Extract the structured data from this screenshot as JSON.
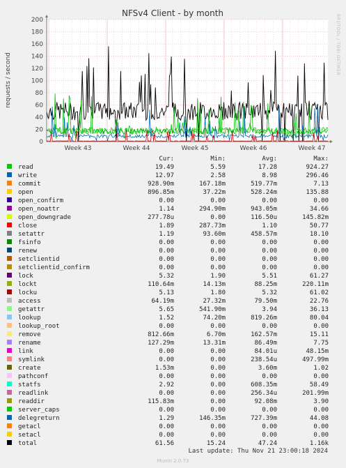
{
  "chart_data": {
    "type": "line",
    "title": "NFSv4 Client - by month",
    "ylabel": "requests / second",
    "side_label": "RRDTOOL / TOBI OETIKER",
    "ylim": [
      0,
      200
    ],
    "yticks": [
      0,
      20,
      40,
      60,
      80,
      100,
      120,
      140,
      160,
      180,
      200
    ],
    "xticks": [
      "Week 43",
      "Week 44",
      "Week 45",
      "Week 46",
      "Week 47"
    ],
    "grid": true,
    "series": [
      {
        "name": "total",
        "color": "#000000",
        "approx_level": 50,
        "approx_range": [
          0,
          160
        ]
      },
      {
        "name": "getattr",
        "color": "#00cc00",
        "approx_level": 18,
        "approx_range": [
          5,
          40
        ]
      },
      {
        "name": "read",
        "color": "#00bb00",
        "approx_level": 17,
        "approx_range": [
          5,
          80
        ]
      },
      {
        "name": "write",
        "color": "#0066b3",
        "approx_level": 9,
        "approx_range": [
          2,
          60
        ]
      },
      {
        "name": "close",
        "color": "#cc0000",
        "approx_level": 1,
        "approx_range": [
          0,
          20
        ]
      }
    ]
  },
  "legend": {
    "headers": {
      "cur": "Cur:",
      "min": "Min:",
      "avg": "Avg:",
      "max": "Max:"
    },
    "rows": [
      {
        "name": "read",
        "color": "#00cc00",
        "cur": "19.49",
        "min": "5.59",
        "avg": "17.28",
        "max": "924.27"
      },
      {
        "name": "write",
        "color": "#0066b3",
        "cur": "12.97",
        "min": "2.58",
        "avg": "8.98",
        "max": "296.46"
      },
      {
        "name": "commit",
        "color": "#ff8000",
        "cur": "928.90m",
        "min": "167.18m",
        "avg": "519.77m",
        "max": "7.13"
      },
      {
        "name": "open",
        "color": "#ffcc00",
        "cur": "896.85m",
        "min": "37.22m",
        "avg": "528.24m",
        "max": "135.88"
      },
      {
        "name": "open_confirm",
        "color": "#330099",
        "cur": "0.00",
        "min": "0.00",
        "avg": "0.00",
        "max": "0.00"
      },
      {
        "name": "open_noattr",
        "color": "#990099",
        "cur": "1.14",
        "min": "294.90m",
        "avg": "943.05m",
        "max": "34.66"
      },
      {
        "name": "open_downgrade",
        "color": "#ccff00",
        "cur": "277.78u",
        "min": "0.00",
        "avg": "116.50u",
        "max": "145.82m"
      },
      {
        "name": "close",
        "color": "#ff0000",
        "cur": "1.89",
        "min": "287.73m",
        "avg": "1.10",
        "max": "50.77"
      },
      {
        "name": "setattr",
        "color": "#808080",
        "cur": "1.19",
        "min": "93.60m",
        "avg": "458.57m",
        "max": "18.10"
      },
      {
        "name": "fsinfo",
        "color": "#008f00",
        "cur": "0.00",
        "min": "0.00",
        "avg": "0.00",
        "max": "0.00"
      },
      {
        "name": "renew",
        "color": "#00487d",
        "cur": "0.00",
        "min": "0.00",
        "avg": "0.00",
        "max": "0.00"
      },
      {
        "name": "setclientid",
        "color": "#b35a00",
        "cur": "0.00",
        "min": "0.00",
        "avg": "0.00",
        "max": "0.00"
      },
      {
        "name": "setclientid_confirm",
        "color": "#b38f00",
        "cur": "0.00",
        "min": "0.00",
        "avg": "0.00",
        "max": "0.00"
      },
      {
        "name": "lock",
        "color": "#6b006b",
        "cur": "5.32",
        "min": "1.90",
        "avg": "5.51",
        "max": "61.27"
      },
      {
        "name": "lockt",
        "color": "#8fb300",
        "cur": "110.64m",
        "min": "14.13m",
        "avg": "88.25m",
        "max": "220.11m"
      },
      {
        "name": "locku",
        "color": "#b30000",
        "cur": "5.13",
        "min": "1.80",
        "avg": "5.32",
        "max": "61.02"
      },
      {
        "name": "access",
        "color": "#bebebe",
        "cur": "64.19m",
        "min": "27.32m",
        "avg": "79.50m",
        "max": "22.76"
      },
      {
        "name": "getattr",
        "color": "#80ff80",
        "cur": "5.65",
        "min": "541.90m",
        "avg": "3.94",
        "max": "36.13"
      },
      {
        "name": "lookup",
        "color": "#80c9ff",
        "cur": "1.52",
        "min": "74.20m",
        "avg": "819.26m",
        "max": "80.04"
      },
      {
        "name": "lookup_root",
        "color": "#ffc080",
        "cur": "0.00",
        "min": "0.00",
        "avg": "0.00",
        "max": "0.00"
      },
      {
        "name": "remove",
        "color": "#ffe680",
        "cur": "812.66m",
        "min": "6.70m",
        "avg": "162.57m",
        "max": "15.11"
      },
      {
        "name": "rename",
        "color": "#aa80ff",
        "cur": "127.29m",
        "min": "13.31m",
        "avg": "86.49m",
        "max": "7.75"
      },
      {
        "name": "link",
        "color": "#ee00cc",
        "cur": "0.00",
        "min": "0.00",
        "avg": "84.01u",
        "max": "48.15m"
      },
      {
        "name": "symlink",
        "color": "#ff8080",
        "cur": "0.00",
        "min": "0.00",
        "avg": "238.54u",
        "max": "497.99m"
      },
      {
        "name": "create",
        "color": "#666600",
        "cur": "1.53m",
        "min": "0.00",
        "avg": "3.60m",
        "max": "1.02"
      },
      {
        "name": "pathconf",
        "color": "#ffbfff",
        "cur": "0.00",
        "min": "0.00",
        "avg": "0.00",
        "max": "0.00"
      },
      {
        "name": "statfs",
        "color": "#00ffcc",
        "cur": "2.92",
        "min": "0.00",
        "avg": "608.35m",
        "max": "58.49"
      },
      {
        "name": "readlink",
        "color": "#cc6699",
        "cur": "0.00",
        "min": "0.00",
        "avg": "256.34u",
        "max": "201.99m"
      },
      {
        "name": "readdir",
        "color": "#999900",
        "cur": "115.83m",
        "min": "0.00",
        "avg": "92.08m",
        "max": "3.90"
      },
      {
        "name": "server_caps",
        "color": "#00cc00",
        "cur": "0.00",
        "min": "0.00",
        "avg": "0.00",
        "max": "0.00"
      },
      {
        "name": "delegreturn",
        "color": "#0066b3",
        "cur": "1.29",
        "min": "146.35m",
        "avg": "727.39m",
        "max": "44.08"
      },
      {
        "name": "getacl",
        "color": "#ff8000",
        "cur": "0.00",
        "min": "0.00",
        "avg": "0.00",
        "max": "0.00"
      },
      {
        "name": "setacl",
        "color": "#ffcc00",
        "cur": "0.00",
        "min": "0.00",
        "avg": "0.00",
        "max": "0.00"
      },
      {
        "name": "total",
        "color": "#000000",
        "cur": "61.56",
        "min": "15.24",
        "avg": "47.24",
        "max": "1.16k"
      }
    ]
  },
  "footer": {
    "last_update": "Last update: Thu Nov 21 23:00:18 2024",
    "munin": "Munin 2.0.73"
  }
}
